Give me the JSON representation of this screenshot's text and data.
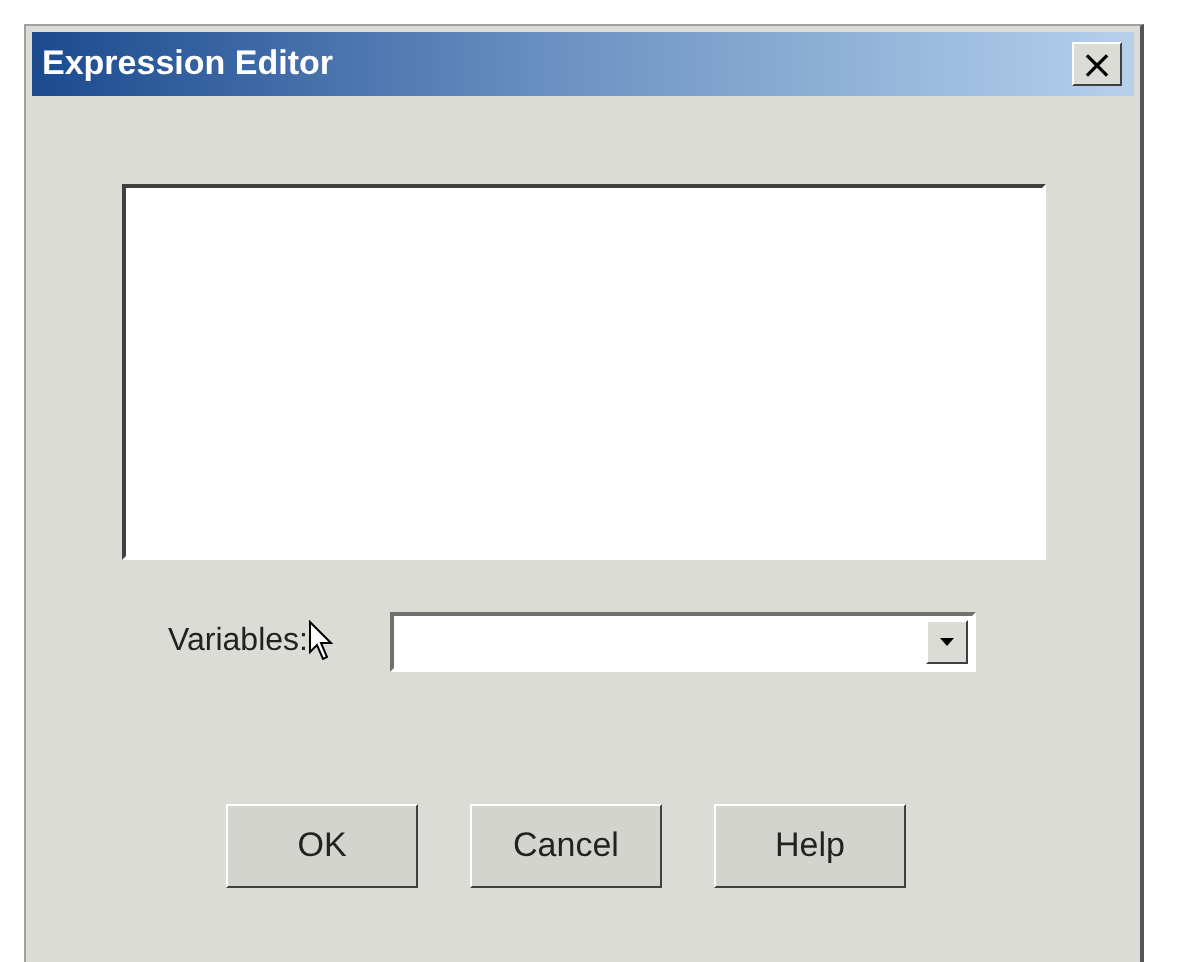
{
  "window": {
    "title": "Expression Editor",
    "close": "×"
  },
  "variables": {
    "label": "Variables:"
  },
  "buttons": [
    {
      "label": "OK"
    },
    {
      "label": "Cancel"
    },
    {
      "label": "Help"
    }
  ]
}
